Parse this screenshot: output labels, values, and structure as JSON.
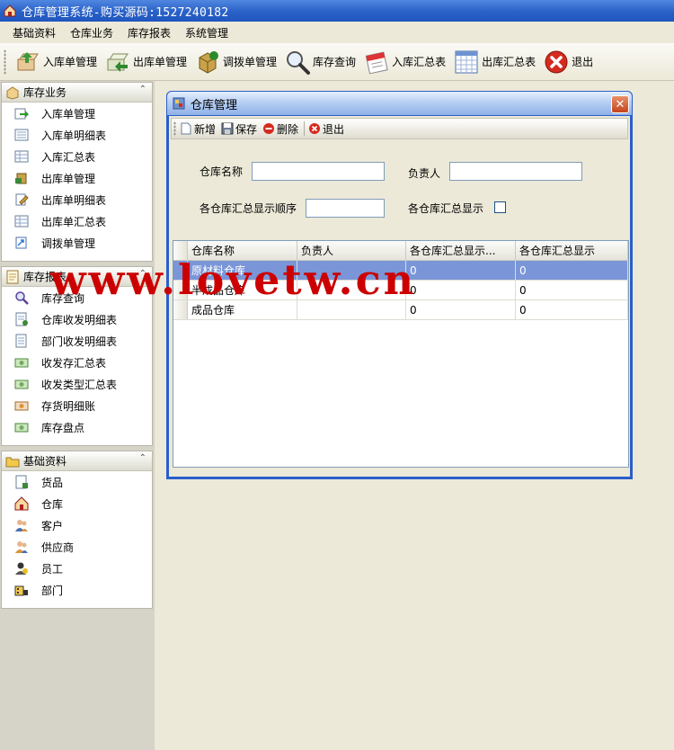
{
  "window": {
    "title": "仓库管理系统-购买源码:1527240182"
  },
  "menubar": {
    "items": [
      "基础资料",
      "仓库业务",
      "库存报表",
      "系统管理"
    ]
  },
  "toolbar": {
    "buttons": [
      {
        "label": "入库单管理",
        "icon": "stock-in-icon"
      },
      {
        "label": "出库单管理",
        "icon": "stock-out-icon"
      },
      {
        "label": "调拨单管理",
        "icon": "transfer-icon"
      },
      {
        "label": "库存查询",
        "icon": "magnifier-icon"
      },
      {
        "label": "入库汇总表",
        "icon": "calendar-icon"
      },
      {
        "label": "出库汇总表",
        "icon": "grid-icon"
      },
      {
        "label": "退出",
        "icon": "exit-icon"
      }
    ]
  },
  "sidebar": {
    "panels": [
      {
        "title": "库存业务",
        "items": [
          "入库单管理",
          "入库单明细表",
          "入库汇总表",
          "出库单管理",
          "出库单明细表",
          "出库单汇总表",
          "调拨单管理"
        ]
      },
      {
        "title": "库存报表",
        "items": [
          "库存查询",
          "仓库收发明细表",
          "部门收发明细表",
          "收发存汇总表",
          "收发类型汇总表",
          "存货明细账",
          "库存盘点"
        ]
      },
      {
        "title": "基础资料",
        "items": [
          "货品",
          "仓库",
          "客户",
          "供应商",
          "员工",
          "部门"
        ]
      }
    ],
    "collapse_glyph": "⌃"
  },
  "child": {
    "title": "仓库管理",
    "close_glyph": "✕",
    "toolbar": {
      "new": "新增",
      "save": "保存",
      "delete": "删除",
      "exit": "退出"
    },
    "form": {
      "name_label": "仓库名称",
      "name_value": "",
      "owner_label": "负责人",
      "owner_value": "",
      "order_label": "各仓库汇总显示顺序",
      "order_value": "",
      "show_label": "各仓库汇总显示",
      "show_checked": false
    },
    "grid": {
      "columns": [
        "仓库名称",
        "负责人",
        "各仓库汇总显示...",
        "各仓库汇总显示"
      ],
      "rows": [
        [
          "原材料仓库",
          "",
          "0",
          "0"
        ],
        [
          "半成品仓库",
          "",
          "0",
          "0"
        ],
        [
          "成品仓库",
          "",
          "0",
          "0"
        ]
      ],
      "selected_row": 0
    }
  },
  "watermark": "www.lovetw.cn",
  "colors": {
    "title_blue": "#2a61c7",
    "selection": "#7a96d8",
    "watermark": "#cc0000"
  }
}
